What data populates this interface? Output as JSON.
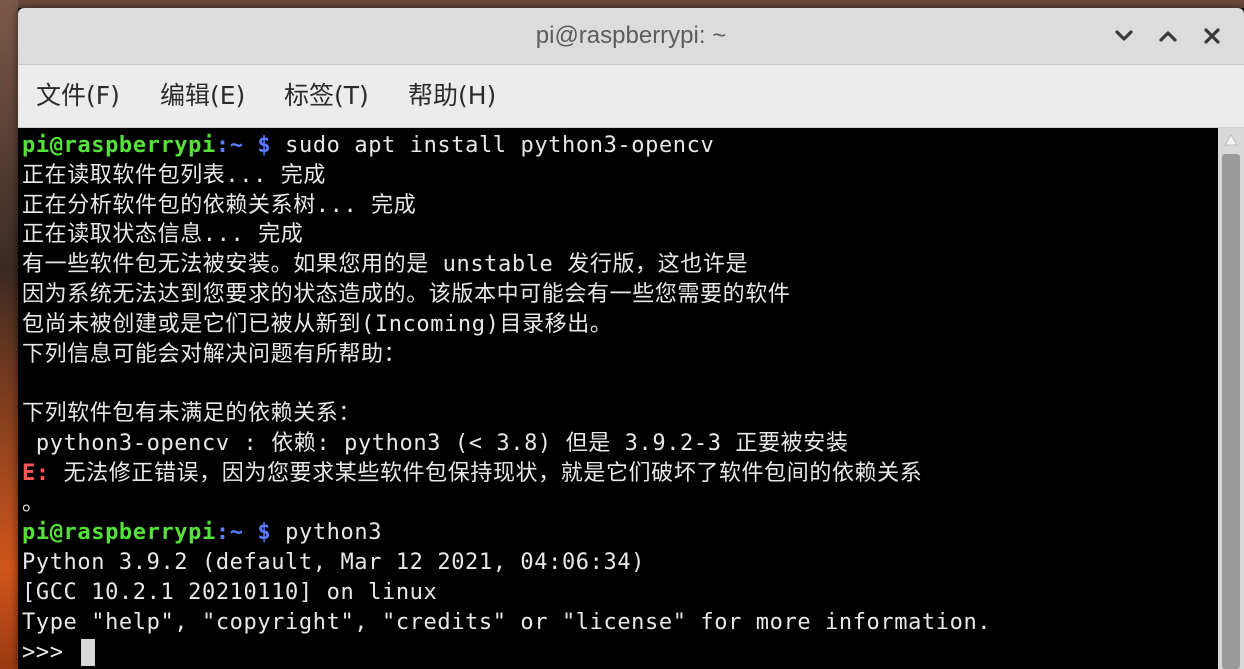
{
  "window": {
    "title": "pi@raspberrypi: ~",
    "controls": {
      "minimize_icon": "chevron-down-icon",
      "maximize_icon": "chevron-up-icon",
      "close_icon": "close-icon"
    }
  },
  "menubar": {
    "items": [
      {
        "label": "文件(F)"
      },
      {
        "label": "编辑(E)"
      },
      {
        "label": "标签(T)"
      },
      {
        "label": "帮助(H)"
      }
    ]
  },
  "terminal": {
    "colors": {
      "user": "#55e03a",
      "path": "#5a7cff",
      "text": "#e8e8e8",
      "error": "#ff5555",
      "background": "#000000"
    },
    "prompt": {
      "user_host": "pi@raspberrypi",
      "colon": ":",
      "path": "~",
      "sign": "$"
    },
    "lines": [
      {
        "type": "prompt",
        "command": " sudo apt install python3-opencv"
      },
      {
        "type": "text",
        "text": "正在读取软件包列表... 完成"
      },
      {
        "type": "text",
        "text": "正在分析软件包的依赖关系树... 完成"
      },
      {
        "type": "text",
        "text": "正在读取状态信息... 完成"
      },
      {
        "type": "text",
        "text": "有一些软件包无法被安装。如果您用的是 unstable 发行版，这也许是"
      },
      {
        "type": "text",
        "text": "因为系统无法达到您要求的状态造成的。该版本中可能会有一些您需要的软件"
      },
      {
        "type": "text",
        "text": "包尚未被创建或是它们已被从新到(Incoming)目录移出。"
      },
      {
        "type": "text",
        "text": "下列信息可能会对解决问题有所帮助："
      },
      {
        "type": "text",
        "text": ""
      },
      {
        "type": "text",
        "text": "下列软件包有未满足的依赖关系："
      },
      {
        "type": "text",
        "text": " python3-opencv : 依赖: python3 (< 3.8) 但是 3.9.2-3 正要被安装"
      },
      {
        "type": "error",
        "label": "E:",
        "text": " 无法修正错误，因为您要求某些软件包保持现状，就是它们破坏了软件包间的依赖关系"
      },
      {
        "type": "text",
        "text": "。"
      },
      {
        "type": "prompt",
        "command": " python3"
      },
      {
        "type": "text",
        "text": "Python 3.9.2 (default, Mar 12 2021, 04:06:34)"
      },
      {
        "type": "text",
        "text": "[GCC 10.2.1 20210110] on linux"
      },
      {
        "type": "text",
        "text": "Type \"help\", \"copyright\", \"credits\" or \"license\" for more information."
      },
      {
        "type": "repl",
        "text": ">>> "
      }
    ]
  },
  "scrollbar": {
    "up_icon": "triangle-up-icon"
  }
}
